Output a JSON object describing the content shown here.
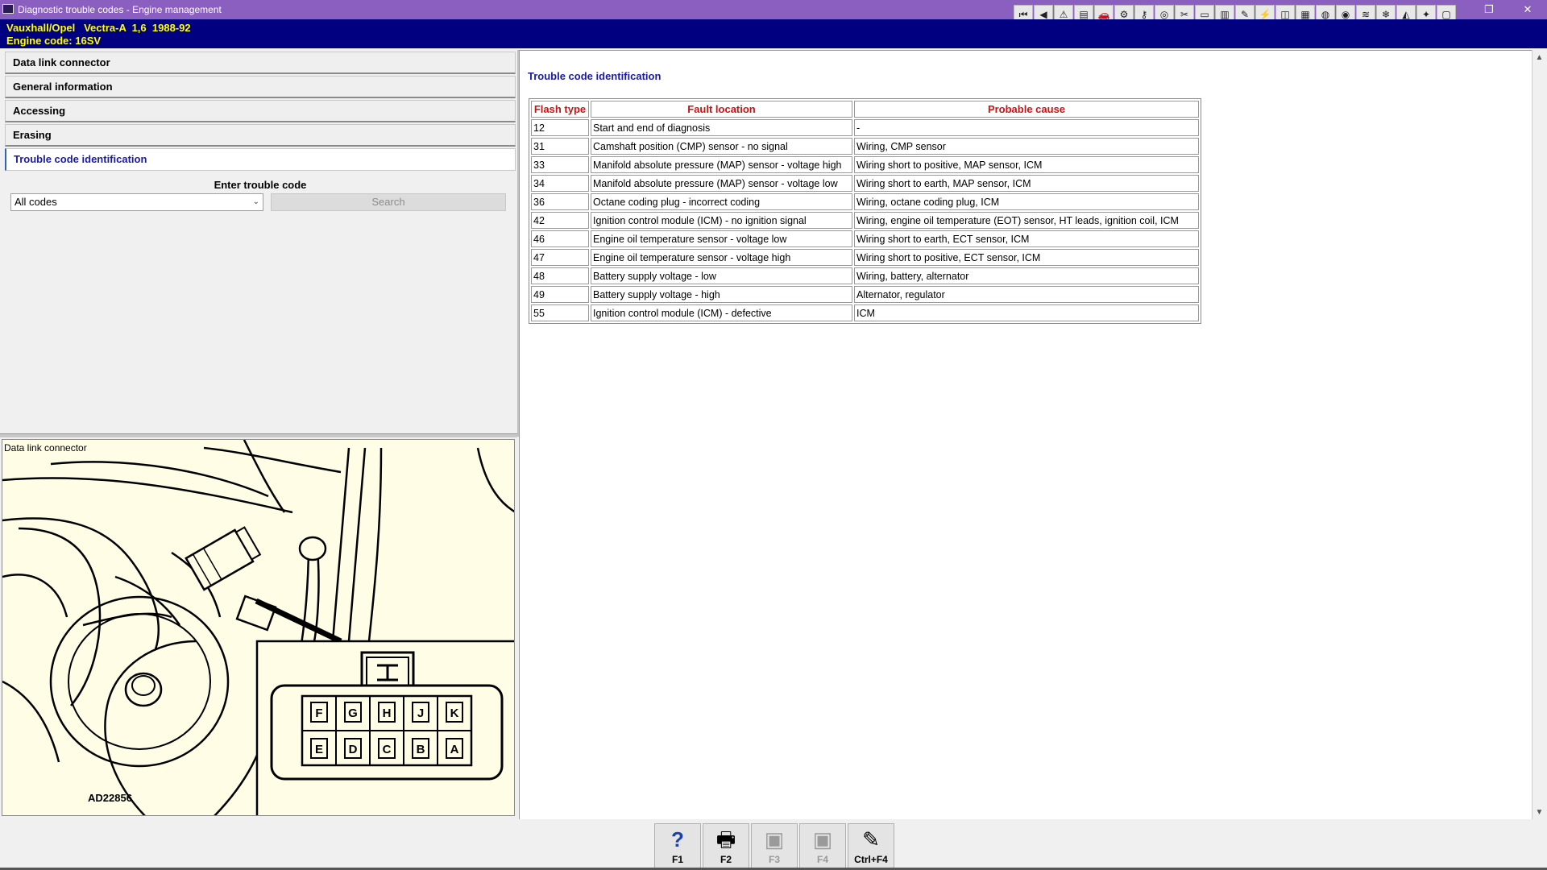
{
  "window": {
    "title": "Diagnostic trouble codes - Engine management",
    "restore_glyph": "❐",
    "close_glyph": "✕"
  },
  "toolbar": {
    "buttons": [
      {
        "name": "first-icon",
        "glyph": "⏮"
      },
      {
        "name": "back-icon",
        "glyph": "◀"
      },
      {
        "name": "warning-icon",
        "glyph": "⚠"
      },
      {
        "name": "page-icon",
        "glyph": "▤"
      },
      {
        "name": "vehicle-icon",
        "glyph": "🚗"
      },
      {
        "name": "engine-icon",
        "glyph": "⚙"
      },
      {
        "name": "key-icon",
        "glyph": "⚷"
      },
      {
        "name": "wheel-icon",
        "glyph": "◎"
      },
      {
        "name": "tools-icon",
        "glyph": "✂"
      },
      {
        "name": "battery-icon",
        "glyph": "▭"
      },
      {
        "name": "book-icon",
        "glyph": "▥"
      },
      {
        "name": "wrench-icon",
        "glyph": "✎"
      },
      {
        "name": "electrical-icon",
        "glyph": "⚡"
      },
      {
        "name": "chip-icon",
        "glyph": "◫"
      },
      {
        "name": "gearbox-icon",
        "glyph": "▦"
      },
      {
        "name": "steering-icon",
        "glyph": "◍"
      },
      {
        "name": "brake-icon",
        "glyph": "◉"
      },
      {
        "name": "suspension-icon",
        "glyph": "≋"
      },
      {
        "name": "aircon-icon",
        "glyph": "❄"
      },
      {
        "name": "body-icon",
        "glyph": "◭"
      },
      {
        "name": "service-icon",
        "glyph": "✦"
      },
      {
        "name": "notes-icon",
        "glyph": "▢"
      }
    ]
  },
  "vehicle": {
    "line1": "Vauxhall/Opel   Vectra-A  1,6  1988-92",
    "line2": "Engine code: 16SV"
  },
  "nav": {
    "items": [
      {
        "label": "Data link connector"
      },
      {
        "label": "General information"
      },
      {
        "label": "Accessing"
      },
      {
        "label": "Erasing"
      },
      {
        "label": "Trouble code identification"
      }
    ]
  },
  "search": {
    "label": "Enter trouble code",
    "select_value": "All codes",
    "button_label": "Search"
  },
  "image_panel": {
    "caption": "Data link connector",
    "figure_code": "AD22856",
    "pins_top": [
      "F",
      "G",
      "H",
      "J",
      "K"
    ],
    "pins_bottom": [
      "E",
      "D",
      "C",
      "B",
      "A"
    ]
  },
  "content": {
    "heading": "Trouble code identification",
    "table": {
      "headers": [
        "Flash type",
        "Fault location",
        "Probable cause"
      ],
      "rows": [
        [
          "12",
          "Start and end of diagnosis",
          "-"
        ],
        [
          "31",
          "Camshaft position (CMP) sensor - no signal",
          "Wiring, CMP sensor"
        ],
        [
          "33",
          "Manifold absolute pressure (MAP) sensor - voltage high",
          "Wiring short to positive, MAP sensor, ICM"
        ],
        [
          "34",
          "Manifold absolute pressure (MAP) sensor - voltage low",
          "Wiring short to earth, MAP sensor, ICM"
        ],
        [
          "36",
          "Octane coding plug - incorrect coding",
          "Wiring, octane coding plug, ICM"
        ],
        [
          "42",
          "Ignition control module (ICM) - no ignition signal",
          "Wiring, engine oil temperature (EOT) sensor, HT leads, ignition coil, ICM"
        ],
        [
          "46",
          "Engine oil temperature sensor - voltage low",
          "Wiring short to earth, ECT sensor, ICM"
        ],
        [
          "47",
          "Engine oil temperature sensor - voltage high",
          "Wiring short to positive, ECT sensor, ICM"
        ],
        [
          "48",
          "Battery supply voltage - low",
          "Wiring, battery, alternator"
        ],
        [
          "49",
          "Battery supply voltage - high",
          "Alternator, regulator"
        ],
        [
          "55",
          "Ignition control module (ICM) - defective",
          "ICM"
        ]
      ]
    }
  },
  "fkeys": [
    {
      "label": "F1",
      "glyph": "?",
      "icon": "help-icon",
      "enabled": true
    },
    {
      "label": "F2",
      "glyph": "🖶",
      "icon": "print-icon",
      "enabled": true
    },
    {
      "label": "F3",
      "glyph": "▣",
      "icon": "copy-icon",
      "enabled": false
    },
    {
      "label": "F4",
      "glyph": "▣",
      "icon": "paste-icon",
      "enabled": false
    },
    {
      "label": "Ctrl+F4",
      "glyph": "✎",
      "icon": "notes-edit-icon",
      "enabled": true
    }
  ],
  "colors": {
    "titlebar": "#8b5fbf",
    "vehiclebar": "#000080",
    "vehicle_text": "#ffff00",
    "header_red": "#cc1111",
    "link_blue": "#1a1aa8",
    "figure_bg": "#fffde6"
  }
}
